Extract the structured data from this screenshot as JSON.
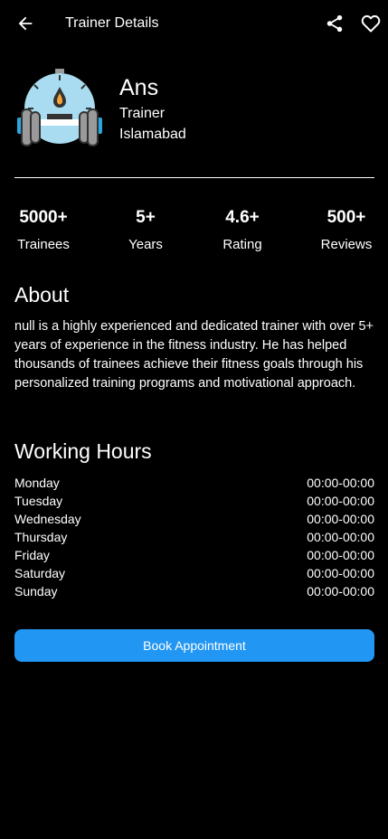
{
  "appbar": {
    "title": "Trainer Details",
    "back_icon": "arrow-back-icon",
    "share_icon": "share-icon",
    "favorite_icon": "heart-outline-icon"
  },
  "profile": {
    "name": "Ans",
    "role": "Trainer",
    "city": "Islamabad",
    "avatar_icon": "dumbbell-stopwatch-icon"
  },
  "stats": [
    {
      "value": "5000+",
      "label": "Trainees"
    },
    {
      "value": "5+",
      "label": "Years"
    },
    {
      "value": "4.6+",
      "label": "Rating"
    },
    {
      "value": "500+",
      "label": "Reviews"
    }
  ],
  "about": {
    "title": "About",
    "text": "null is a highly experienced and dedicated trainer with over 5+ years of experience in the fitness industry. He has helped thousands of trainees achieve their fitness goals through his personalized training programs and motivational approach."
  },
  "working_hours": {
    "title": "Working Hours",
    "days": [
      {
        "day": "Monday",
        "time": "00:00-00:00"
      },
      {
        "day": "Tuesday",
        "time": "00:00-00:00"
      },
      {
        "day": "Wednesday",
        "time": "00:00-00:00"
      },
      {
        "day": "Thursday",
        "time": "00:00-00:00"
      },
      {
        "day": "Friday",
        "time": "00:00-00:00"
      },
      {
        "day": "Saturday",
        "time": "00:00-00:00"
      },
      {
        "day": "Sunday",
        "time": "00:00-00:00"
      }
    ]
  },
  "book_button": {
    "label": "Book Appointment"
  },
  "colors": {
    "background": "#000000",
    "text": "#ffffff",
    "accent": "#2196f3",
    "avatar_light_blue": "#a9dcf0",
    "avatar_gray": "#9a9a9a",
    "avatar_orange": "#f5a33a"
  }
}
